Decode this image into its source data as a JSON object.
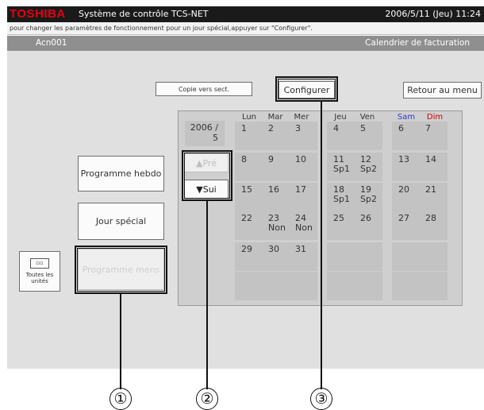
{
  "header": {
    "logo": "TOSHIBA",
    "title": "Système de contrôle TCS-NET",
    "datetime": "2006/5/11 (Jeu) 11:24"
  },
  "hint": "pour changer les paramètres de fonctionnement pour un jour spécial,appuyer sur \"Configurer\".",
  "section": {
    "left": "Acn001",
    "right": "Calendrier de facturation"
  },
  "toolbar": {
    "copie_label": "Copie vers sect.",
    "configurer_label": "Configurer",
    "retour_label": "Retour au menu"
  },
  "side_buttons": {
    "hebdo_label": "Programme hebdo",
    "jour_label": "Jour spécial",
    "mens_label": "Programme mens",
    "toutes_label": "Toutes les unités",
    "toutes_icon": "units-icon"
  },
  "nav": {
    "pre_label": "▲Pré",
    "sui_label": "▼Sui"
  },
  "calendar": {
    "month_label": "2006 / 5",
    "day_headers": [
      "Lun",
      "Mar",
      "Mer",
      "Jeu",
      "Ven",
      "Sam",
      "Dim"
    ],
    "day_header_colors": [
      "#333333",
      "#333333",
      "#333333",
      "#333333",
      "#333333",
      "#3333cc",
      "#cc0000"
    ],
    "weeks": [
      [
        {
          "day": "1",
          "tag": ""
        },
        {
          "day": "2",
          "tag": ""
        },
        {
          "day": "3",
          "tag": ""
        },
        {
          "day": "4",
          "tag": ""
        },
        {
          "day": "5",
          "tag": ""
        },
        {
          "day": "6",
          "tag": ""
        },
        {
          "day": "7",
          "tag": ""
        }
      ],
      [
        {
          "day": "8",
          "tag": ""
        },
        {
          "day": "9",
          "tag": ""
        },
        {
          "day": "10",
          "tag": ""
        },
        {
          "day": "11",
          "tag": "Sp1"
        },
        {
          "day": "12",
          "tag": "Sp2"
        },
        {
          "day": "13",
          "tag": ""
        },
        {
          "day": "14",
          "tag": ""
        }
      ],
      [
        {
          "day": "15",
          "tag": ""
        },
        {
          "day": "16",
          "tag": ""
        },
        {
          "day": "17",
          "tag": ""
        },
        {
          "day": "18",
          "tag": "Sp1"
        },
        {
          "day": "19",
          "tag": "Sp2"
        },
        {
          "day": "20",
          "tag": ""
        },
        {
          "day": "21",
          "tag": ""
        }
      ],
      [
        {
          "day": "22",
          "tag": ""
        },
        {
          "day": "23",
          "tag": "Non"
        },
        {
          "day": "24",
          "tag": "Non"
        },
        {
          "day": "25",
          "tag": ""
        },
        {
          "day": "26",
          "tag": ""
        },
        {
          "day": "27",
          "tag": ""
        },
        {
          "day": "28",
          "tag": ""
        }
      ],
      [
        {
          "day": "29",
          "tag": ""
        },
        {
          "day": "30",
          "tag": ""
        },
        {
          "day": "31",
          "tag": ""
        },
        {
          "day": "",
          "tag": ""
        },
        {
          "day": "",
          "tag": ""
        },
        {
          "day": "",
          "tag": ""
        },
        {
          "day": "",
          "tag": ""
        }
      ],
      [
        {
          "day": "",
          "tag": ""
        },
        {
          "day": "",
          "tag": ""
        },
        {
          "day": "",
          "tag": ""
        },
        {
          "day": "",
          "tag": ""
        },
        {
          "day": "",
          "tag": ""
        },
        {
          "day": "",
          "tag": ""
        },
        {
          "day": "",
          "tag": ""
        }
      ]
    ]
  },
  "callouts": [
    "①",
    "②",
    "③"
  ]
}
